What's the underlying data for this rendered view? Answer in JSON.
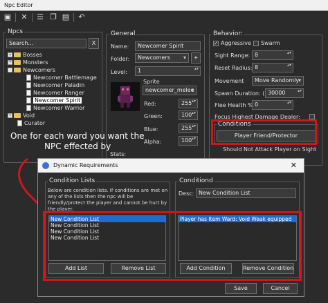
{
  "window": {
    "title": "Npc Editor"
  },
  "npcs": {
    "title": "Npcs",
    "search_value": "Search...",
    "clear_label": "X",
    "tree": [
      {
        "label": "Bosses",
        "kind": "folder",
        "expander": "+"
      },
      {
        "label": "Monsters",
        "kind": "folder",
        "expander": "+"
      },
      {
        "label": "Newcomers",
        "kind": "folder",
        "expander": "-"
      },
      {
        "label": "Newcomer Battlemage",
        "kind": "npc"
      },
      {
        "label": "Newcomer Paladin",
        "kind": "npc"
      },
      {
        "label": "Newcomer Ranger",
        "kind": "npc"
      },
      {
        "label": "Newcomer Spirit",
        "kind": "npc",
        "selected": true
      },
      {
        "label": "Newcomer Warrior",
        "kind": "npc"
      },
      {
        "label": "Void",
        "kind": "folder",
        "expander": "+"
      },
      {
        "label": "Curator",
        "kind": "npc"
      }
    ]
  },
  "general": {
    "title": "General",
    "name_label": "Name:",
    "name_value": "Newcomer Spirit",
    "folder_label": "Folder:",
    "folder_value": "Newcomers",
    "folder_add": "+",
    "level_label": "Level:",
    "level_value": "1",
    "sprite_label": "Sprite",
    "sprite_value": "newcomer_melee",
    "red_label": "Red:",
    "red_value": "255",
    "green_label": "Green:",
    "green_value": "100",
    "blue_label": "Blue:",
    "blue_value": "255",
    "alpha_label": "Alpha:",
    "alpha_value": "100",
    "stats_label": "Stats:"
  },
  "behavior": {
    "title": "Behavior:",
    "aggressive_label": "Aggressive",
    "aggressive_checked": "✓",
    "swarm_label": "Swarm",
    "sight_label": "Sight Range:",
    "sight_value": "8",
    "reset_label": "Reset Radius:",
    "reset_value": "8",
    "movement_label": "Movement",
    "movement_value": "Move Randomly",
    "spawn_label": "Spawn Duration: (ms)",
    "spawn_value": "30000",
    "flee_label": "Flee Health %",
    "flee_value": "0",
    "focus_label": "Focus Highest Damage Dealer:",
    "conditions_title": "Conditions",
    "conditions_button": "Player Friend/Protector",
    "not_attack_label": "Should Not Attack Player on Sight"
  },
  "annotation": {
    "line1": "One for each ward you want the",
    "line2": "NPC effected by"
  },
  "dialog": {
    "title": "Dynamic Requirements",
    "close_label": "✕",
    "lists_title": "Condition Lists",
    "lists_desc": "Below are condition lists. If conditions are met on any of the lists then the npc will be friendly/protect the player and cannot be hurt by the player.",
    "lists": [
      "New Condition List",
      "New Condition List",
      "New Condition List",
      "New Condition List"
    ],
    "add_list": "Add List",
    "remove_list": "Remove List",
    "cond_title": "Conditiond",
    "desc_label": "Desc:",
    "desc_value": "New Condition List",
    "conditions": [
      "Player has Item Ward: Void Weak equipped"
    ],
    "add_condition": "Add Condition",
    "remove_condition": "Remove Condition",
    "save": "Save",
    "cancel": "Cancel"
  },
  "colors": {
    "annotation_red": "#d0161b",
    "selection_blue": "#1e6bd6"
  }
}
